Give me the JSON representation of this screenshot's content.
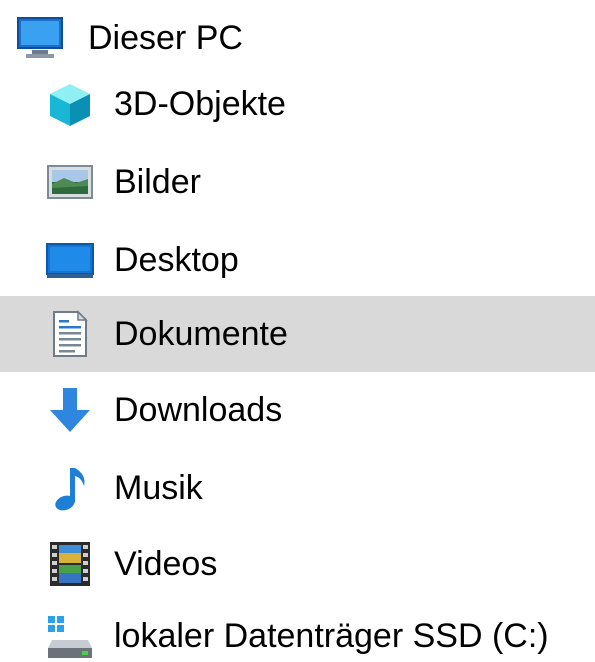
{
  "tree": {
    "root": {
      "label": "Dieser PC",
      "icon": "computer-icon"
    },
    "items": [
      {
        "label": "3D-Objekte",
        "icon": "cube-3d-icon",
        "selected": false
      },
      {
        "label": "Bilder",
        "icon": "pictures-icon",
        "selected": false
      },
      {
        "label": "Desktop",
        "icon": "desktop-icon",
        "selected": false
      },
      {
        "label": "Dokumente",
        "icon": "documents-icon",
        "selected": true
      },
      {
        "label": "Downloads",
        "icon": "download-arrow-icon",
        "selected": false
      },
      {
        "label": "Musik",
        "icon": "music-note-icon",
        "selected": false
      },
      {
        "label": "Videos",
        "icon": "film-icon",
        "selected": false
      },
      {
        "label": "lokaler Datenträger SSD (C:)",
        "icon": "drive-icon",
        "selected": false
      }
    ]
  },
  "colors": {
    "selected_background": "#d9d9d9",
    "accent_blue": "#1e7fd6"
  }
}
